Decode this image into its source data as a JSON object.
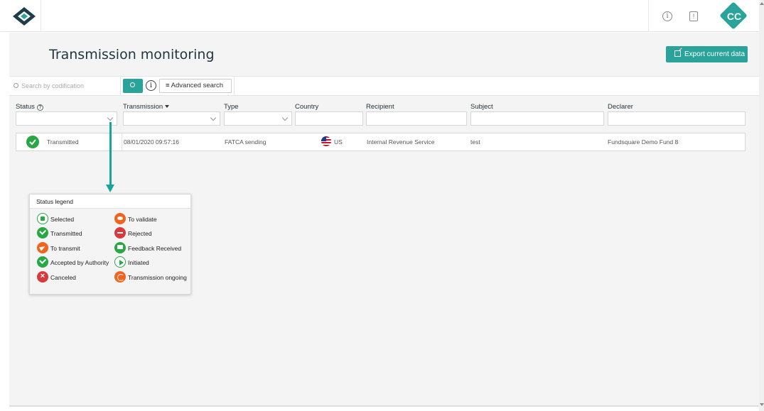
{
  "header": {
    "logo_icon": "fundsquare-logo-icon",
    "info_icon": "info-icon",
    "alert_icon": "alert-icon",
    "avatar_initials": "CC",
    "avatar_color": "#2aa39a"
  },
  "page": {
    "title": "Transmission monitoring",
    "export_label": "Export current data"
  },
  "search": {
    "placeholder": "Search by codification",
    "advanced_label": "Advanced search",
    "search_icon": "search-icon"
  },
  "columns": {
    "status": "Status",
    "transmission": "Transmission",
    "type": "Type",
    "country": "Country",
    "recipient": "Recipient",
    "subject": "Subject",
    "declarer": "Declarer"
  },
  "rows": [
    {
      "status": "Transmitted",
      "transmission": "08/01/2020 09:57:16",
      "type": "FATCA sending",
      "country": "US",
      "recipient": "Internal Revenue Service",
      "subject": "test",
      "declarer": "Fundsquare Demo Fund 8"
    }
  ],
  "legend": {
    "title": "Status legend",
    "items": {
      "selected": "Selected",
      "to_validate": "To validate",
      "transmitted": "Transmitted",
      "rejected": "Rejected",
      "to_transmit": "To transmit",
      "feedback_received": "Feedback Received",
      "accepted": "Accepted by Authority",
      "initiated": "Initiated",
      "canceled": "Canceled",
      "ongoing": "Transmission ongoing"
    }
  },
  "colors": {
    "accent": "#2aa39a",
    "success": "#28a745",
    "warning": "#f0641e",
    "danger": "#d63a3a"
  }
}
